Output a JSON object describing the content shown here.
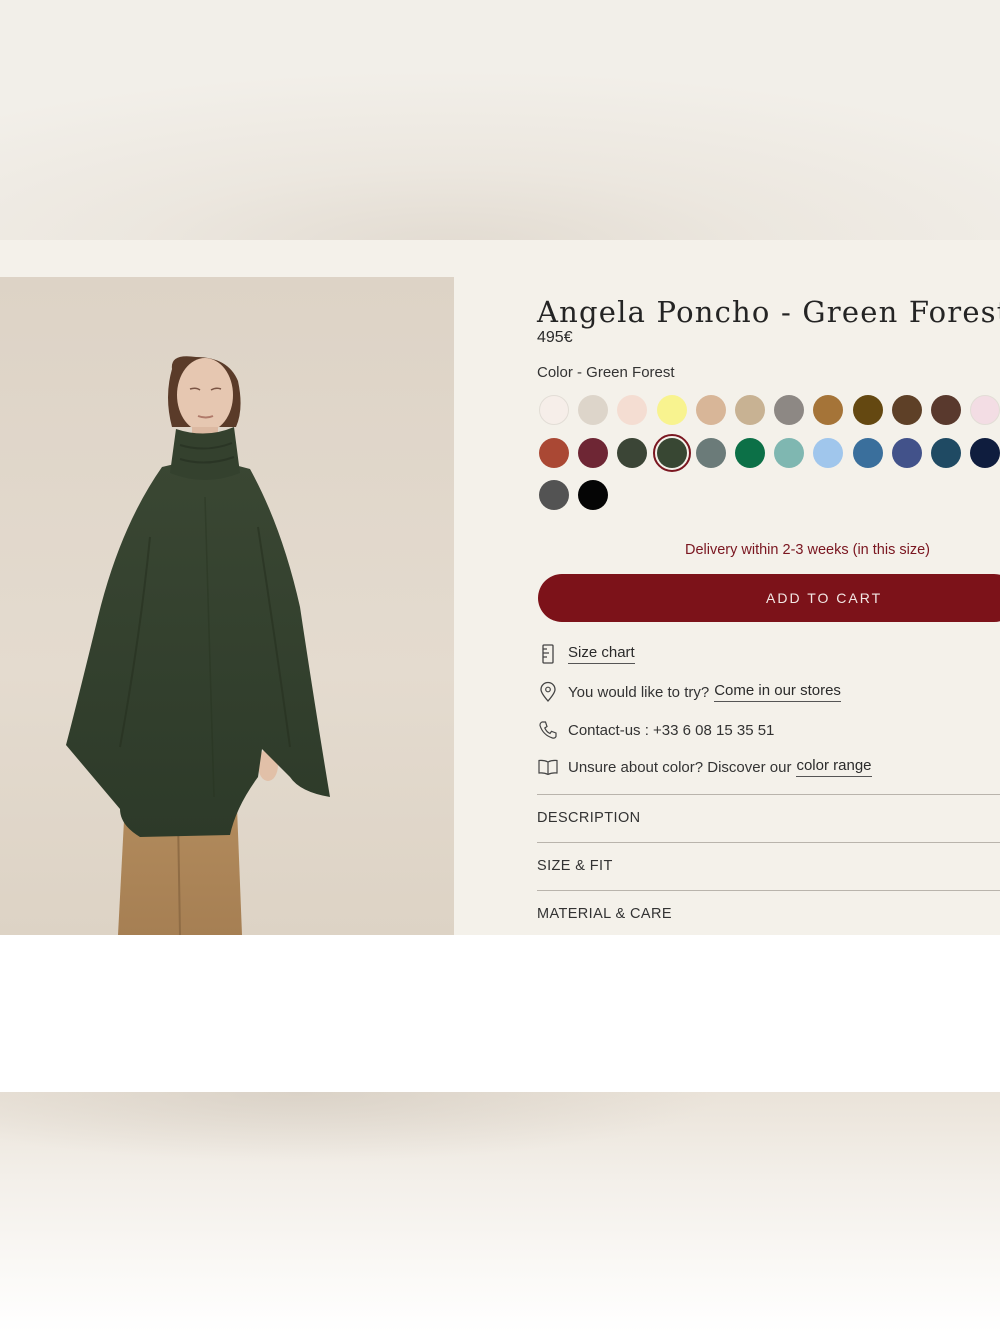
{
  "product": {
    "title": "Angela Poncho - Green Forest",
    "price": "495€",
    "color_label": "Color - Green Forest",
    "selected_color": "#384733"
  },
  "swatches": [
    [
      "#f6eee9",
      "#ddd5ca",
      "#f4ddd2",
      "#f8f38f",
      "#d8b698",
      "#c8b293",
      "#8d8884",
      "#a57438",
      "#644811",
      "#5e4027",
      "#59392d",
      "#f3dde4"
    ],
    [
      "#aa4834",
      "#6e2634",
      "#3b4536",
      "#384733",
      "#6b7b79",
      "#0c7047",
      "#7fb7b1",
      "#a0c6ec",
      "#3a6f9c",
      "#42528a",
      "#1f4a63",
      "#0f1d3e"
    ],
    [
      "#535353",
      "#050505"
    ]
  ],
  "delivery_text": "Delivery within 2-3 weeks (in this size)",
  "add_to_cart_label": "ADD TO CART",
  "links": {
    "size_chart": "Size chart",
    "try_text": "You would like to try?",
    "stores_link": "Come in our stores",
    "contact": "Contact-us : +33 6 08 15 35 51",
    "color_text": "Unsure about color? Discover our",
    "color_link": "color range"
  },
  "accordion": [
    "DESCRIPTION",
    "SIZE & FIT",
    "MATERIAL & CARE"
  ],
  "icons": {
    "size_chart": "ruler-icon",
    "stores": "location-pin-icon",
    "contact": "phone-icon",
    "color_range": "book-icon"
  },
  "colors": {
    "accent": "#7c1219",
    "panel_bg": "#f4f1ea"
  }
}
